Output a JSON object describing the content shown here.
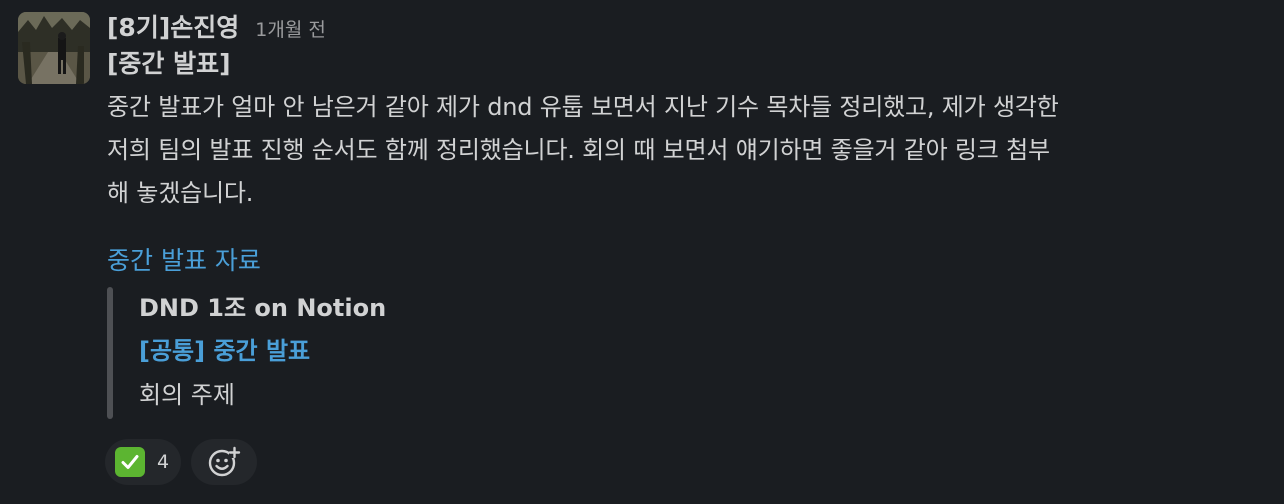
{
  "message": {
    "sender": "[8기]손진영",
    "timestamp": "1개월 전",
    "title": "[중간 발표]",
    "body_lines": [
      "중간 발표가 얼마 안 남은거 같아 제가 dnd 유툽 보면서 지난 기수 목차들 정리했고, 제가 생각한",
      "저희 팀의 발표 진행 순서도 함께 정리했습니다. 회의 때 보면서 얘기하면 좋을거 같아 링크 첨부",
      "해 놓겠습니다."
    ],
    "link_text": "중간 발표 자료"
  },
  "unfurl": {
    "site": "DND 1조 on Notion",
    "title": "[공통] 중간 발표",
    "description": "회의 주제"
  },
  "reactions": [
    {
      "icon": "white-check-mark-icon",
      "count": "4"
    }
  ],
  "colors": {
    "background": "#1a1d21",
    "text": "#d1d2d3",
    "link": "#4a9fd8",
    "muted": "#9a9b9d",
    "check_green": "#5cb531"
  }
}
